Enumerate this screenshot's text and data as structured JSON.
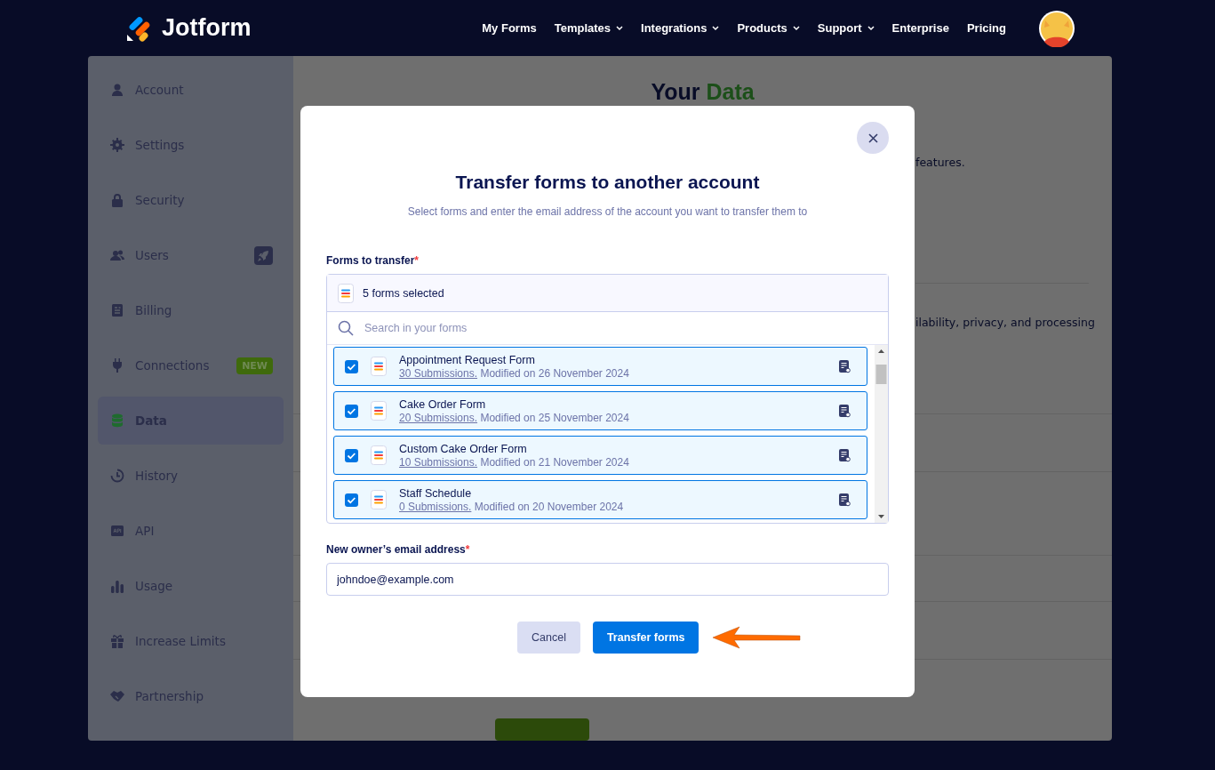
{
  "header": {
    "logo": "Jotform",
    "nav": [
      {
        "label": "My Forms",
        "dropdown": false
      },
      {
        "label": "Templates",
        "dropdown": true
      },
      {
        "label": "Integrations",
        "dropdown": true
      },
      {
        "label": "Products",
        "dropdown": true
      },
      {
        "label": "Support",
        "dropdown": true
      },
      {
        "label": "Enterprise",
        "dropdown": false
      },
      {
        "label": "Pricing",
        "dropdown": false
      }
    ]
  },
  "sidebar": {
    "items": [
      {
        "label": "Account",
        "selected": false
      },
      {
        "label": "Settings",
        "selected": false
      },
      {
        "label": "Security",
        "selected": false
      },
      {
        "label": "Users",
        "selected": false
      },
      {
        "label": "Billing",
        "selected": false
      },
      {
        "label": "Connections",
        "selected": false,
        "badge": "NEW"
      },
      {
        "label": "Data",
        "selected": true
      },
      {
        "label": "History",
        "selected": false
      },
      {
        "label": "API",
        "selected": false
      },
      {
        "label": "Usage",
        "selected": false
      },
      {
        "label": "Increase Limits",
        "selected": false
      },
      {
        "label": "Partnership",
        "selected": false
      }
    ]
  },
  "page": {
    "heading": "Your",
    "heading_highlight": "Data",
    "fragments": [
      "features.",
      "ilability, privacy, and processing"
    ]
  },
  "modal": {
    "title": "Transfer forms to another account",
    "subtitle": "Select forms and enter the email address of the account you want to transfer them to",
    "forms_label": "Forms to transfer",
    "required_mark": "*",
    "selection_summary": "5 forms selected",
    "search": {
      "placeholder": "Search in your forms"
    },
    "forms": [
      {
        "title": "Appointment Request Form",
        "submissions": "30 Submissions.",
        "modified": "Modified on 26 November 2024",
        "checked": true
      },
      {
        "title": "Cake Order Form",
        "submissions": "20 Submissions.",
        "modified": "Modified on 25 November 2024",
        "checked": true
      },
      {
        "title": "Custom Cake Order Form",
        "submissions": "10 Submissions.",
        "modified": "Modified on 21 November 2024",
        "checked": true
      },
      {
        "title": "Staff Schedule",
        "submissions": "0 Submissions.",
        "modified": "Modified on 20 November 2024",
        "checked": true
      }
    ],
    "email_label": "New owner’s email address",
    "email_required_mark": "*",
    "email": {
      "value": "johndoe@example.com"
    },
    "buttons": {
      "cancel": "Cancel",
      "submit": "Transfer forms"
    }
  }
}
